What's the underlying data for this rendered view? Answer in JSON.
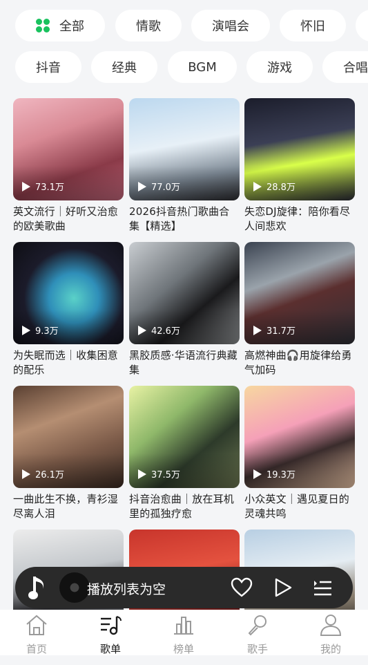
{
  "chips_row1": [
    {
      "label": "全部",
      "icon": "clover-icon"
    },
    {
      "label": "情歌"
    },
    {
      "label": "演唱会"
    },
    {
      "label": "怀旧"
    },
    {
      "label": ""
    }
  ],
  "chips_row2": [
    {
      "label": "抖音"
    },
    {
      "label": "经典"
    },
    {
      "label": "BGM"
    },
    {
      "label": "游戏"
    },
    {
      "label": "合唱"
    }
  ],
  "playlists": [
    {
      "plays": "73.1万",
      "title": "英文流行｜好听又治愈的欧美歌曲"
    },
    {
      "plays": "77.0万",
      "title": "2026抖音热门歌曲合集【精选】"
    },
    {
      "plays": "28.8万",
      "title": "失恋DJ旋律：陪你看尽人间悲欢"
    },
    {
      "plays": "9.3万",
      "title": "为失眠而选｜收集困意的配乐"
    },
    {
      "plays": "42.6万",
      "title": "黑胶质感·华语流行典藏集"
    },
    {
      "plays": "31.7万",
      "title": "高燃神曲🎧用旋律给勇气加码"
    },
    {
      "plays": "26.1万",
      "title": "一曲此生不换，青衫湿尽离人泪"
    },
    {
      "plays": "37.5万",
      "title": "抖音治愈曲｜放在耳机里的孤独疗愈"
    },
    {
      "plays": "19.3万",
      "title": "小众英文｜遇见夏日的灵魂共鸣"
    },
    {
      "plays": "",
      "title": ""
    },
    {
      "plays": "",
      "title": ""
    },
    {
      "plays": "",
      "title": ""
    }
  ],
  "player": {
    "status": "播放列表为空"
  },
  "nav": [
    {
      "label": "首页",
      "icon": "home-icon"
    },
    {
      "label": "歌单",
      "icon": "playlist-icon",
      "active": true
    },
    {
      "label": "榜单",
      "icon": "chart-icon"
    },
    {
      "label": "歌手",
      "icon": "microphone-icon"
    },
    {
      "label": "我的",
      "icon": "profile-icon"
    }
  ],
  "colors": {
    "accent": "#19c25e",
    "background": "#f4f5f7",
    "player": "#2a2a2a"
  }
}
